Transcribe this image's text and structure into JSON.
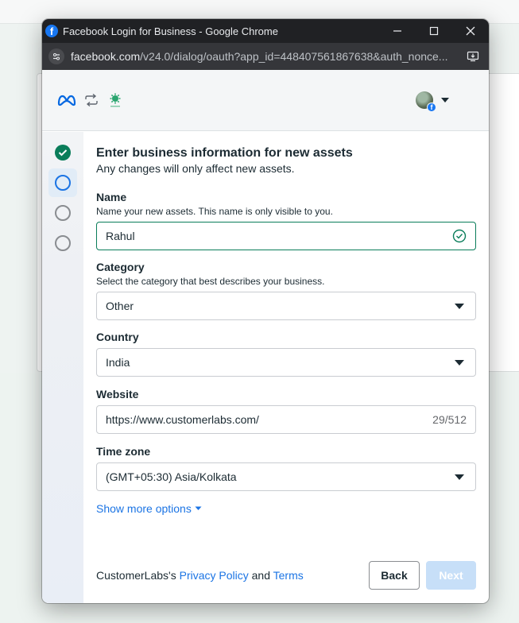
{
  "window": {
    "title": "Facebook Login for Business - Google Chrome",
    "url_host": "facebook.com",
    "url_path": "/v24.0/dialog/oauth?app_id=448407561867638&auth_nonce..."
  },
  "header": {
    "brand_icon": "meta-logo",
    "sync_icon": "sync-arrows-icon",
    "business_icon": "business-logo-icon"
  },
  "steps": [
    {
      "state": "done"
    },
    {
      "state": "current"
    },
    {
      "state": "todo"
    },
    {
      "state": "todo"
    }
  ],
  "form": {
    "title": "Enter business information for new assets",
    "subtitle": "Any changes will only affect new assets.",
    "name": {
      "label": "Name",
      "help": "Name your new assets. This name is only visible to you.",
      "value": "Rahul"
    },
    "category": {
      "label": "Category",
      "help": "Select the category that best describes your business.",
      "value": "Other"
    },
    "country": {
      "label": "Country",
      "value": "India"
    },
    "website": {
      "label": "Website",
      "value": "https://www.customerlabs.com/",
      "counter": "29/512"
    },
    "timezone": {
      "label": "Time zone",
      "value": "(GMT+05:30) Asia/Kolkata"
    },
    "show_more": "Show more options"
  },
  "footer": {
    "prefix": "CustomerLabs's ",
    "privacy_link": "Privacy Policy",
    "and": " and ",
    "terms_link": "Terms",
    "back_label": "Back",
    "next_label": "Next"
  },
  "colors": {
    "accent": "#1b74e4",
    "success": "#0a7d5a",
    "next_disabled": "#c7dff8"
  }
}
